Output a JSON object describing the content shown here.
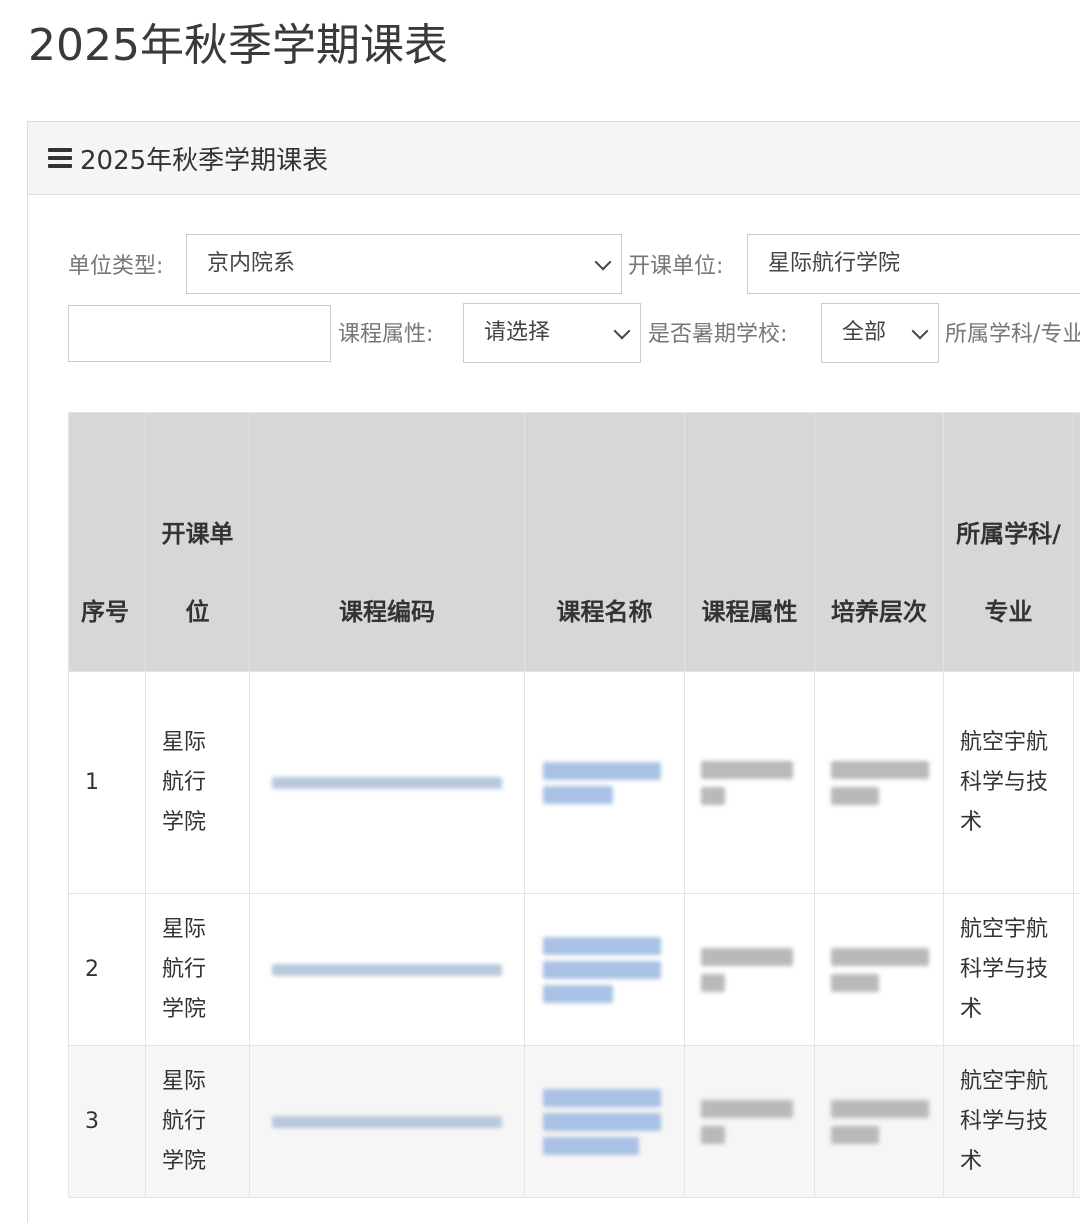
{
  "page": {
    "title": "2025年秋季学期课表"
  },
  "panel": {
    "heading": "2025年秋季学期课表"
  },
  "filters": {
    "unit_type": {
      "label": "单位类型:",
      "value": "京内院系"
    },
    "course_unit": {
      "label": "开课单位:",
      "value": "星际航行学院"
    },
    "course_attr": {
      "label": "课程属性:",
      "value": "请选择"
    },
    "summer_school": {
      "label": "是否暑期学校:",
      "value": "全部"
    },
    "subject": {
      "label": "所属学科/专业"
    }
  },
  "table": {
    "headers": {
      "idx": "序号",
      "unit": "开课单位",
      "code": "课程编码",
      "name": "课程名称",
      "attr": "课程属性",
      "level": "培养层次",
      "major": "所属学科/专业"
    },
    "rows": [
      {
        "idx": "1",
        "unit": "星际航行学院",
        "major": "航空宇航科学与技术"
      },
      {
        "idx": "2",
        "unit": "星际航行学院",
        "major": "航空宇航科学与技术"
      },
      {
        "idx": "3",
        "unit": "星际航行学院",
        "major": "航空宇航科学与技术"
      }
    ]
  }
}
